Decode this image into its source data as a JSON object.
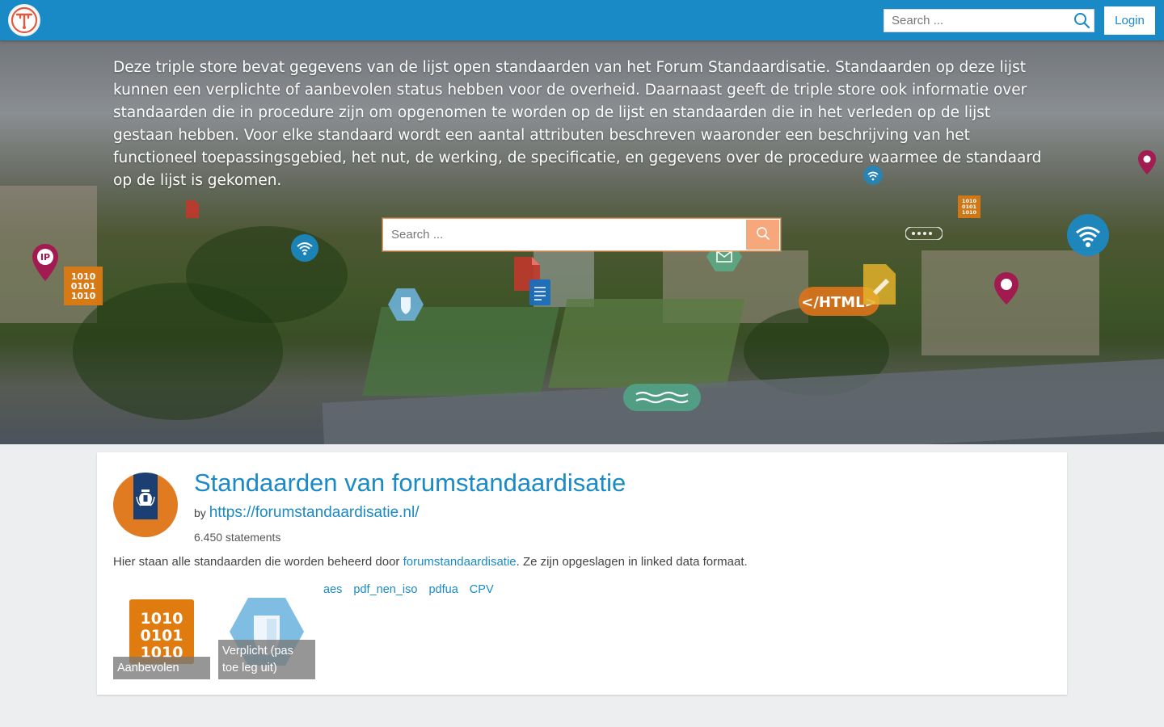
{
  "navbar": {
    "search_placeholder": "Search ...",
    "login_label": "Login",
    "brand_color": "#1a8ac6"
  },
  "hero": {
    "description": "Deze triple store bevat gegevens van de lijst open standaarden van het Forum Standaardisatie. Standaarden op deze lijst kunnen een verplichte of aanbevolen status hebben voor de overheid. Daarnaast geeft de triple store ook informatie over standaarden die in procedure zijn om opgenomen te worden op de lijst en standaarden die in het verleden op de lijst gestaan hebben. Voor elke standaard wordt een aantal attributen beschreven waaronder een beschrijving van het functioneel toepassingsgebied, het nut, de werking, de specificatie, en gegevens over de procedure waarmee de standaard op de lijst is gekomen.",
    "search_placeholder": "Search ...",
    "html_badge": "</HTML>",
    "binary_text": [
      "1010",
      "0101",
      "1010"
    ]
  },
  "dataset": {
    "title": "Standaarden van forumstandaardisatie",
    "by_prefix": "by",
    "owner_url": "https://forumstandaardisatie.nl/",
    "statements": "6.450 statements",
    "description_prefix": "Hier staan alle standaarden die worden beheerd door ",
    "description_link": "forumstandaardisatie",
    "description_suffix": ". Ze zijn opgeslagen in linked data formaat.",
    "thumbnails": [
      {
        "caption": "Aanbevolen",
        "icon": "binary-icon",
        "binary": [
          "1010",
          "0101",
          "1010"
        ]
      },
      {
        "caption": "Verplicht (pas toe leg uit)",
        "icon": "shield-icon"
      }
    ],
    "tags": [
      "aes",
      "pdf_nen_iso",
      "pdfua",
      "CPV"
    ]
  }
}
